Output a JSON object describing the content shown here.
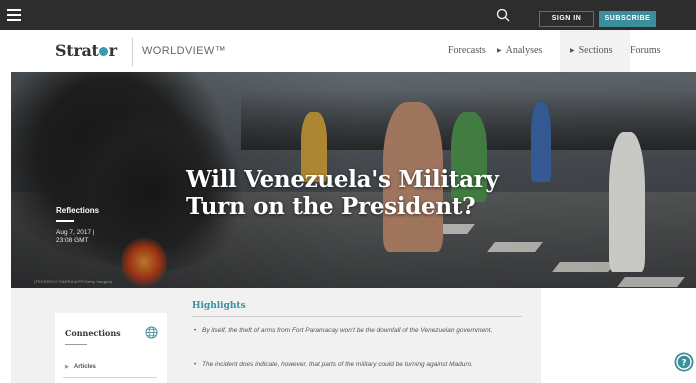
{
  "topbar": {
    "menu_icon": "hamburger-icon",
    "search_icon": "search-icon",
    "sign_in_label": "SIGN IN",
    "subscribe_label": "SUBSCRIBE",
    "accent_color": "#3c8e9c"
  },
  "masthead": {
    "logo_text_left": "Strat",
    "logo_text_right": "r",
    "product_name": "WORLDVIEW™",
    "nav": [
      {
        "label": "Forecasts"
      },
      {
        "label": "Analyses"
      },
      {
        "label": "Sections"
      },
      {
        "label": "Forums"
      }
    ]
  },
  "article": {
    "headline": "Will Venezuela's Military Turn on the President?",
    "category": "Reflections",
    "date_line1": "Aug 7, 2017 |",
    "date_line2": "23:08 GMT",
    "photo_credit": "(FEDERICO PARRA/AFP/Getty Images)"
  },
  "sidebar": {
    "title": "Connections",
    "globe_icon": "globe-icon",
    "articles_label": "Articles"
  },
  "highlights": {
    "title": "Highlights",
    "bullets": [
      "By itself, the theft of arms from Fort Paramacay won't be the downfall of the Venezuelan government.",
      "The incident does indicate, however, that parts of the military could be turning against Maduro."
    ]
  },
  "help_icon": "help-icon"
}
